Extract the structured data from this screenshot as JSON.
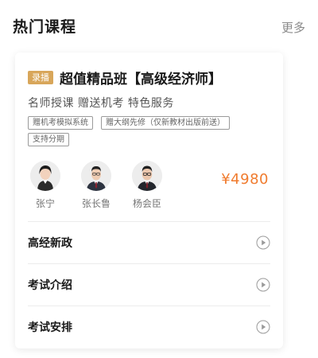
{
  "header": {
    "title": "热门课程",
    "more_label": "更多"
  },
  "course": {
    "badge": "录播",
    "title": "超值精品班【高级经济师】",
    "subtitle": "名师授课 赠送机考 特色服务",
    "tags": [
      "赠机考模拟系统",
      "赠大纲先修（仅新教材出版前送）",
      "支持分期"
    ],
    "teachers": [
      {
        "name": "张宁"
      },
      {
        "name": "张长鲁"
      },
      {
        "name": "杨会臣"
      }
    ],
    "price": "¥4980"
  },
  "menu": {
    "items": [
      {
        "label": "高经新政",
        "icon": "play-circle-icon"
      },
      {
        "label": "考试介绍",
        "icon": "play-circle-icon"
      },
      {
        "label": "考试安排",
        "icon": "play-circle-icon"
      }
    ]
  },
  "colors": {
    "badge": "#d8a65a",
    "price": "#f07b2e"
  }
}
